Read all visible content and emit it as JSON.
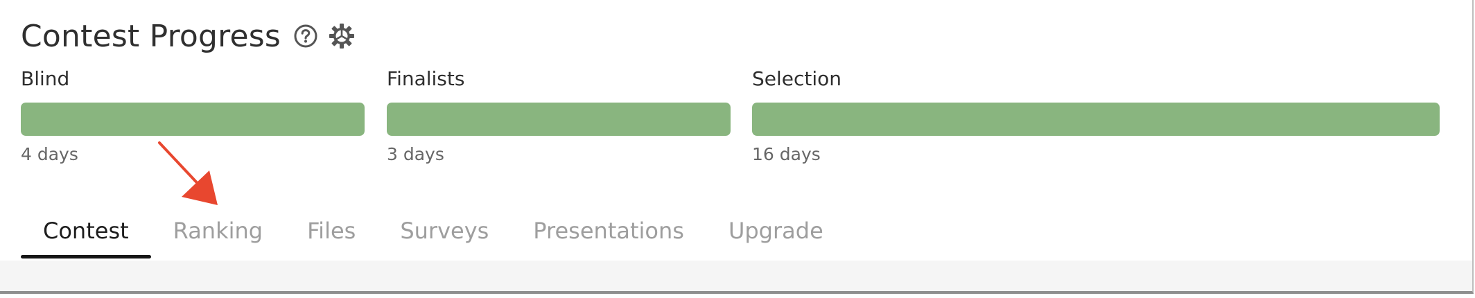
{
  "header": {
    "title": "Contest Progress",
    "help_icon": "help-circle-icon",
    "settings_icon": "gear-icon"
  },
  "stages": [
    {
      "label": "Blind",
      "days": "4 days",
      "progress": 1.0
    },
    {
      "label": "Finalists",
      "days": "3 days",
      "progress": 1.0
    },
    {
      "label": "Selection",
      "days": "16 days",
      "progress": 1.0
    }
  ],
  "tabs": [
    {
      "label": "Contest",
      "active": true
    },
    {
      "label": "Ranking",
      "active": false
    },
    {
      "label": "Files",
      "active": false
    },
    {
      "label": "Surveys",
      "active": false
    },
    {
      "label": "Presentations",
      "active": false
    },
    {
      "label": "Upgrade",
      "active": false
    }
  ],
  "colors": {
    "progress_fill": "#89b57f",
    "active_tab": "#1d1d1d",
    "inactive_tab": "#9e9e9e",
    "annotation_arrow": "#e8472f"
  }
}
